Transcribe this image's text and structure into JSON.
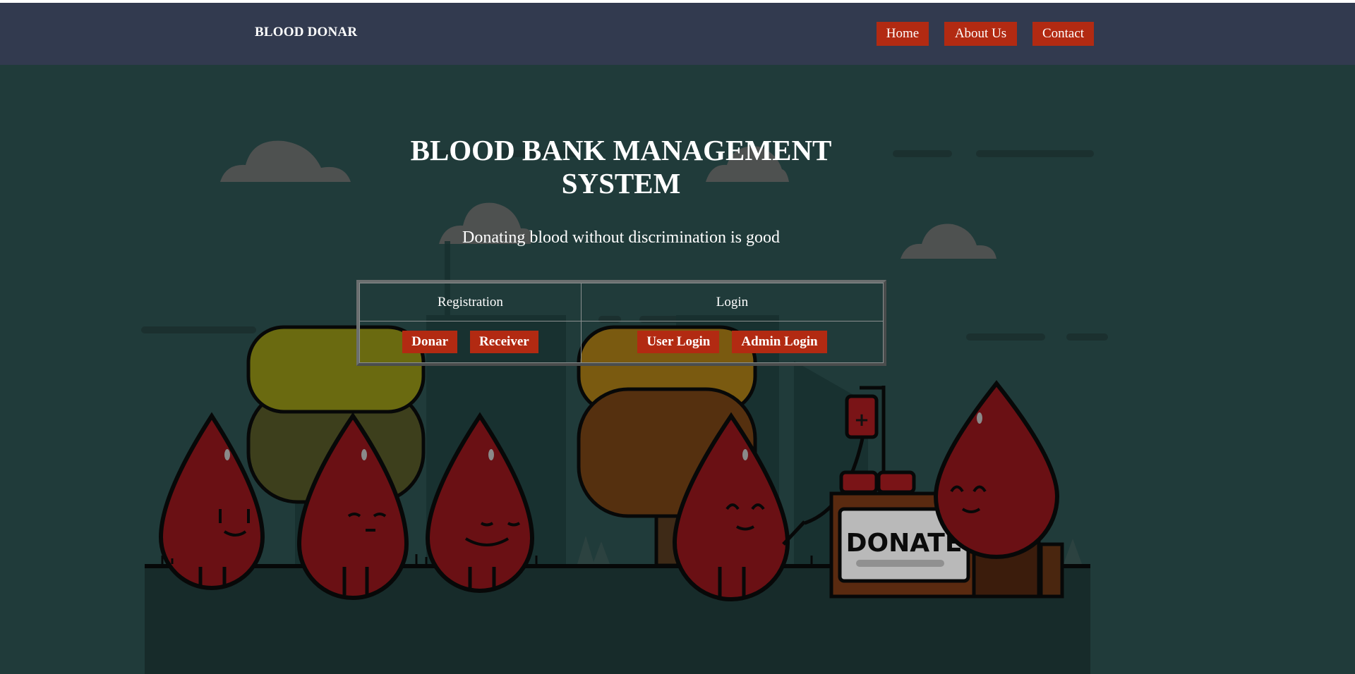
{
  "navbar": {
    "brand": "BLOOD DONAR",
    "links": [
      "Home",
      "About Us",
      "Contact"
    ]
  },
  "hero": {
    "title_line1": "BLOOD BANK MANAGEMENT",
    "title_line2": "SYSTEM",
    "subtitle": "Donating blood without discrimination is good"
  },
  "panel": {
    "registration": {
      "header": "Registration",
      "buttons": [
        "Donar",
        "Receiver"
      ]
    },
    "login": {
      "header": "Login",
      "buttons": [
        "User Login",
        "Admin Login"
      ]
    }
  },
  "illustration": {
    "sign_text": "DONATE"
  },
  "colors": {
    "navbar_bg": "#323a4f",
    "hero_bg": "#203b3a",
    "accent": "#b22a12",
    "drop_red": "#7a1417"
  }
}
